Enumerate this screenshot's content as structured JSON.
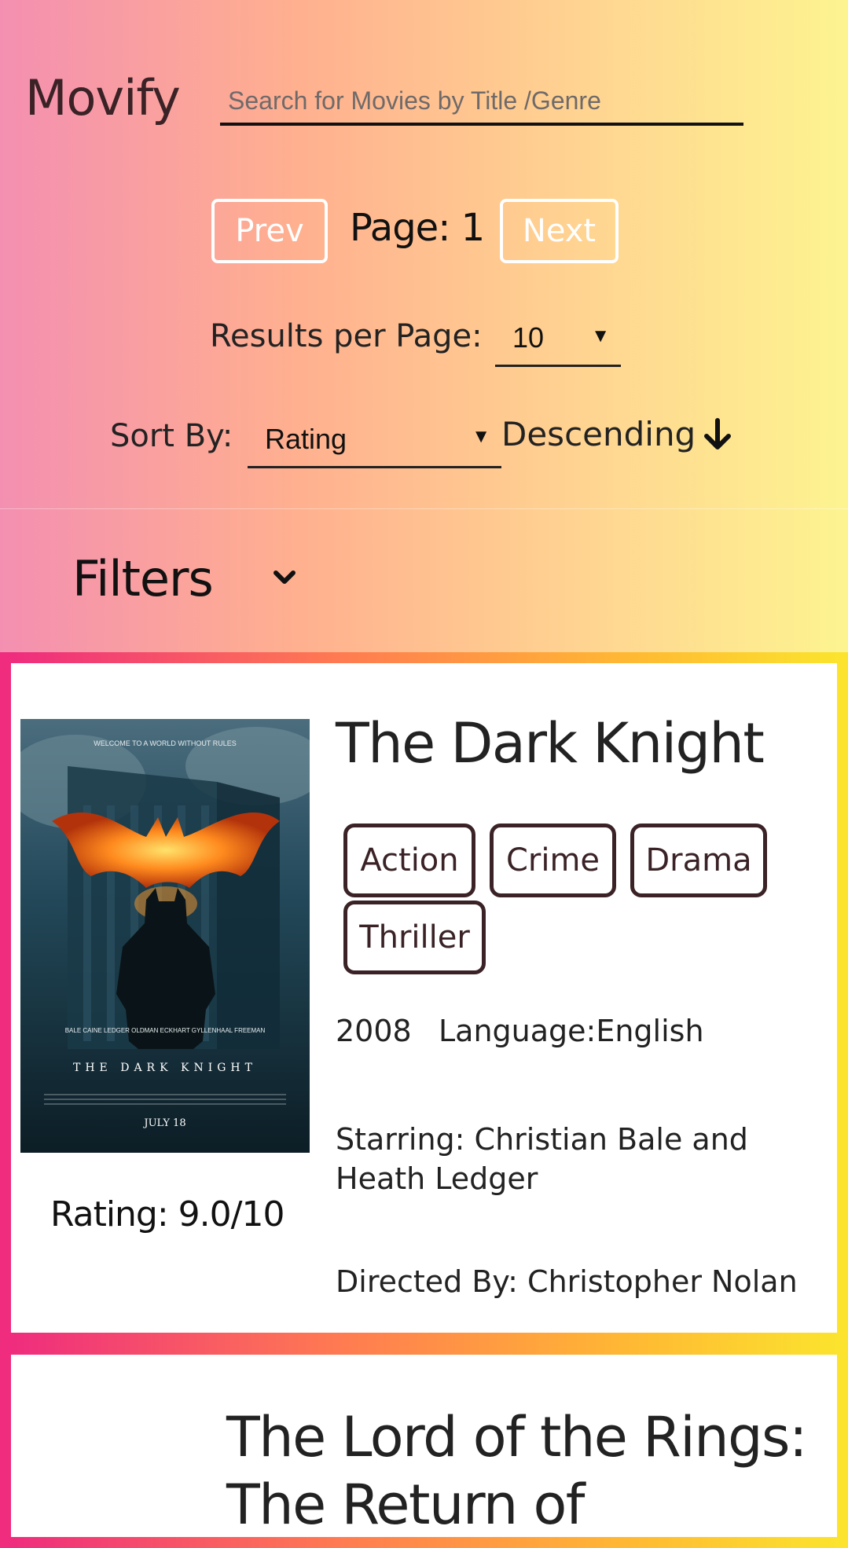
{
  "app": {
    "title": "Movify"
  },
  "search": {
    "placeholder": "Search for Movies by Title /Genre"
  },
  "pagination": {
    "prev_label": "Prev",
    "next_label": "Next",
    "page_text": "Page: 1"
  },
  "results_per_page": {
    "label": "Results per Page:",
    "selected": "10"
  },
  "sort": {
    "label": "Sort By:",
    "selected": "Rating",
    "order_label": "Descending",
    "order_icon": "arrow-down-icon"
  },
  "filters": {
    "label": "Filters",
    "icon": "chevron-down-icon"
  },
  "movies": [
    {
      "title": "The Dark Knight",
      "genres": [
        "Action",
        "Crime",
        "Drama",
        "Thriller"
      ],
      "year": "2008",
      "language": "Language:English",
      "starring": "Starring: Christian Bale and Heath Ledger",
      "director": "Directed By: Christopher Nolan",
      "rating": "Rating: 9.0/10",
      "poster": {
        "tagline": "WELCOME TO A WORLD WITHOUT RULES",
        "credits": "BALE CAINE LEDGER OLDMAN ECKHART GYLLENHAAL FREEMAN",
        "title": "THE DARK KNIGHT",
        "date": "JULY 18"
      }
    },
    {
      "title": "The Lord of the Rings: The Return of"
    }
  ],
  "colors": {
    "header_gradient": [
      "#f48fb1",
      "#ffb08f",
      "#ffd591",
      "#fdf490"
    ],
    "card_border_gradient": [
      "#ef2c7e",
      "#ff7b51",
      "#ffb933",
      "#fbe32e"
    ],
    "genre_border": "#3a2226"
  }
}
